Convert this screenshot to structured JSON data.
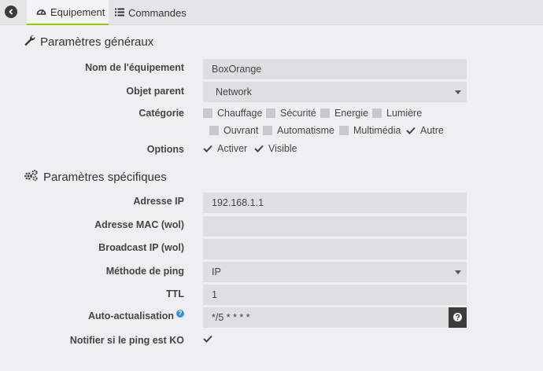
{
  "tabs": [
    {
      "label": "Equipement",
      "icon": "dashboard-icon",
      "active": true
    },
    {
      "label": "Commandes",
      "icon": "list-icon",
      "active": false
    }
  ],
  "general": {
    "title": "Paramètres généraux",
    "name_label": "Nom de l'équipement",
    "name_value": "BoxOrange",
    "parent_label": "Objet parent",
    "parent_value": "Network",
    "category_label": "Catégorie",
    "categories": [
      {
        "label": "Chauffage",
        "checked": false
      },
      {
        "label": "Sécurité",
        "checked": false
      },
      {
        "label": "Energie",
        "checked": false
      },
      {
        "label": "Lumière",
        "checked": false
      },
      {
        "label": "Ouvrant",
        "checked": false
      },
      {
        "label": "Automatisme",
        "checked": false
      },
      {
        "label": "Multimédia",
        "checked": false
      },
      {
        "label": "Autre",
        "checked": true
      }
    ],
    "options_label": "Options",
    "options": [
      {
        "label": "Activer",
        "checked": true
      },
      {
        "label": "Visible",
        "checked": true
      }
    ]
  },
  "specific": {
    "title": "Paramètres spécifiques",
    "ip_label": "Adresse IP",
    "ip_value": "192.168.1.1",
    "mac_label": "Adresse MAC (wol)",
    "mac_value": "",
    "broadcast_label": "Broadcast IP (wol)",
    "broadcast_value": "",
    "ping_method_label": "Méthode de ping",
    "ping_method_value": "IP",
    "ttl_label": "TTL",
    "ttl_value": "1",
    "auto_label": "Auto-actualisation",
    "auto_help": "?",
    "auto_value": "*/5 * * * *",
    "notify_label": "Notifier si le ping est KO",
    "notify_checked": true
  },
  "colors": {
    "accent": "#94ca02",
    "info": "#3b8fd9",
    "dark": "#3c3c3c"
  }
}
